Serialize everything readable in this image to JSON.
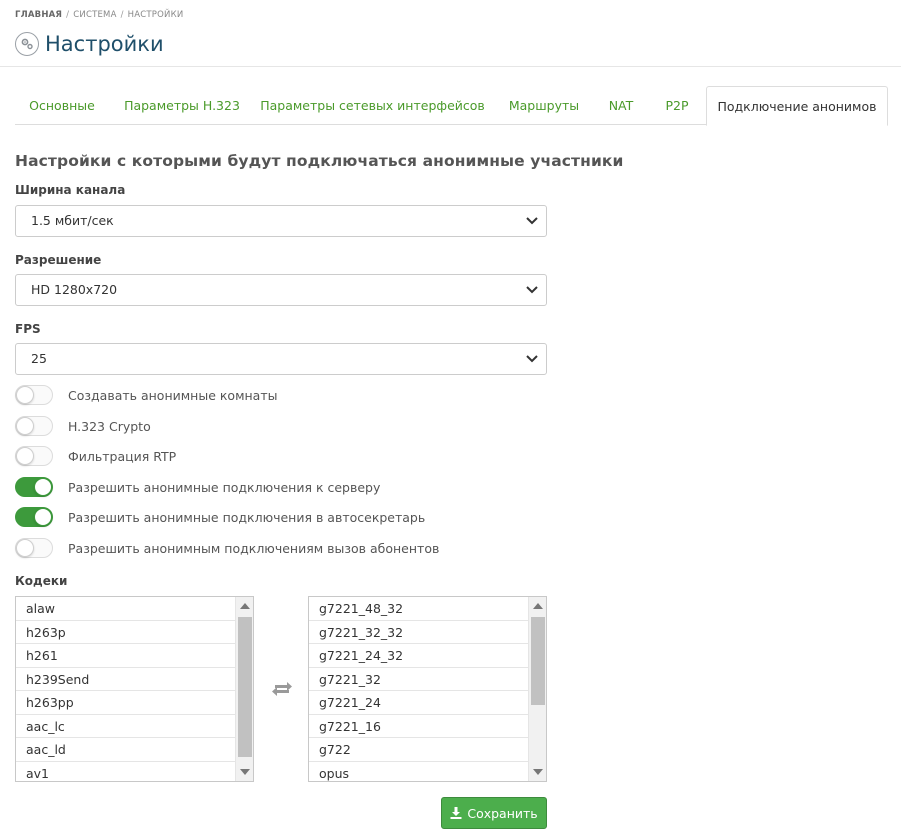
{
  "breadcrumb": {
    "home": "ГЛАВНАЯ",
    "system": "СИСТЕМА",
    "settings": "НАСТРОЙКИ"
  },
  "page": {
    "title": "Настройки"
  },
  "tabs": [
    {
      "label": "Основные"
    },
    {
      "label": "Параметры H.323"
    },
    {
      "label": "Параметры сетевых интерфейсов"
    },
    {
      "label": "Маршруты"
    },
    {
      "label": "NAT"
    },
    {
      "label": "P2P"
    },
    {
      "label": "Подключение анонимов"
    }
  ],
  "section": {
    "title": "Настройки с которыми будут подключаться анонимные участники"
  },
  "bandwidth": {
    "label": "Ширина канала",
    "value": "1.5 мбит/сек"
  },
  "resolution": {
    "label": "Разрешение",
    "value": "HD 1280x720"
  },
  "fps": {
    "label": "FPS",
    "value": "25"
  },
  "toggles": [
    {
      "label": "Создавать анонимные комнаты",
      "on": false
    },
    {
      "label": "H.323 Crypto",
      "on": false
    },
    {
      "label": "Фильтрация RTP",
      "on": false
    },
    {
      "label": "Разрешить анонимные подключения к серверу",
      "on": true
    },
    {
      "label": "Разрешить анонимные подключения в автосекретарь",
      "on": true
    },
    {
      "label": "Разрешить анонимным подключениям вызов абонентов",
      "on": false
    }
  ],
  "codecs": {
    "label": "Кодеки",
    "available": [
      "alaw",
      "h263p",
      "h261",
      "h239Send",
      "h263pp",
      "aac_lc",
      "aac_ld",
      "av1"
    ],
    "selected": [
      "g7221_48_32",
      "g7221_32_32",
      "g7221_24_32",
      "g7221_32",
      "g7221_24",
      "g7221_16",
      "g722",
      "opus"
    ]
  },
  "save_button": {
    "label": "Сохранить"
  },
  "colors": {
    "accent": "#4a9a2a",
    "toggle_on": "#3d9a3c",
    "button": "#4cae4c",
    "title": "#1f4f6a"
  }
}
